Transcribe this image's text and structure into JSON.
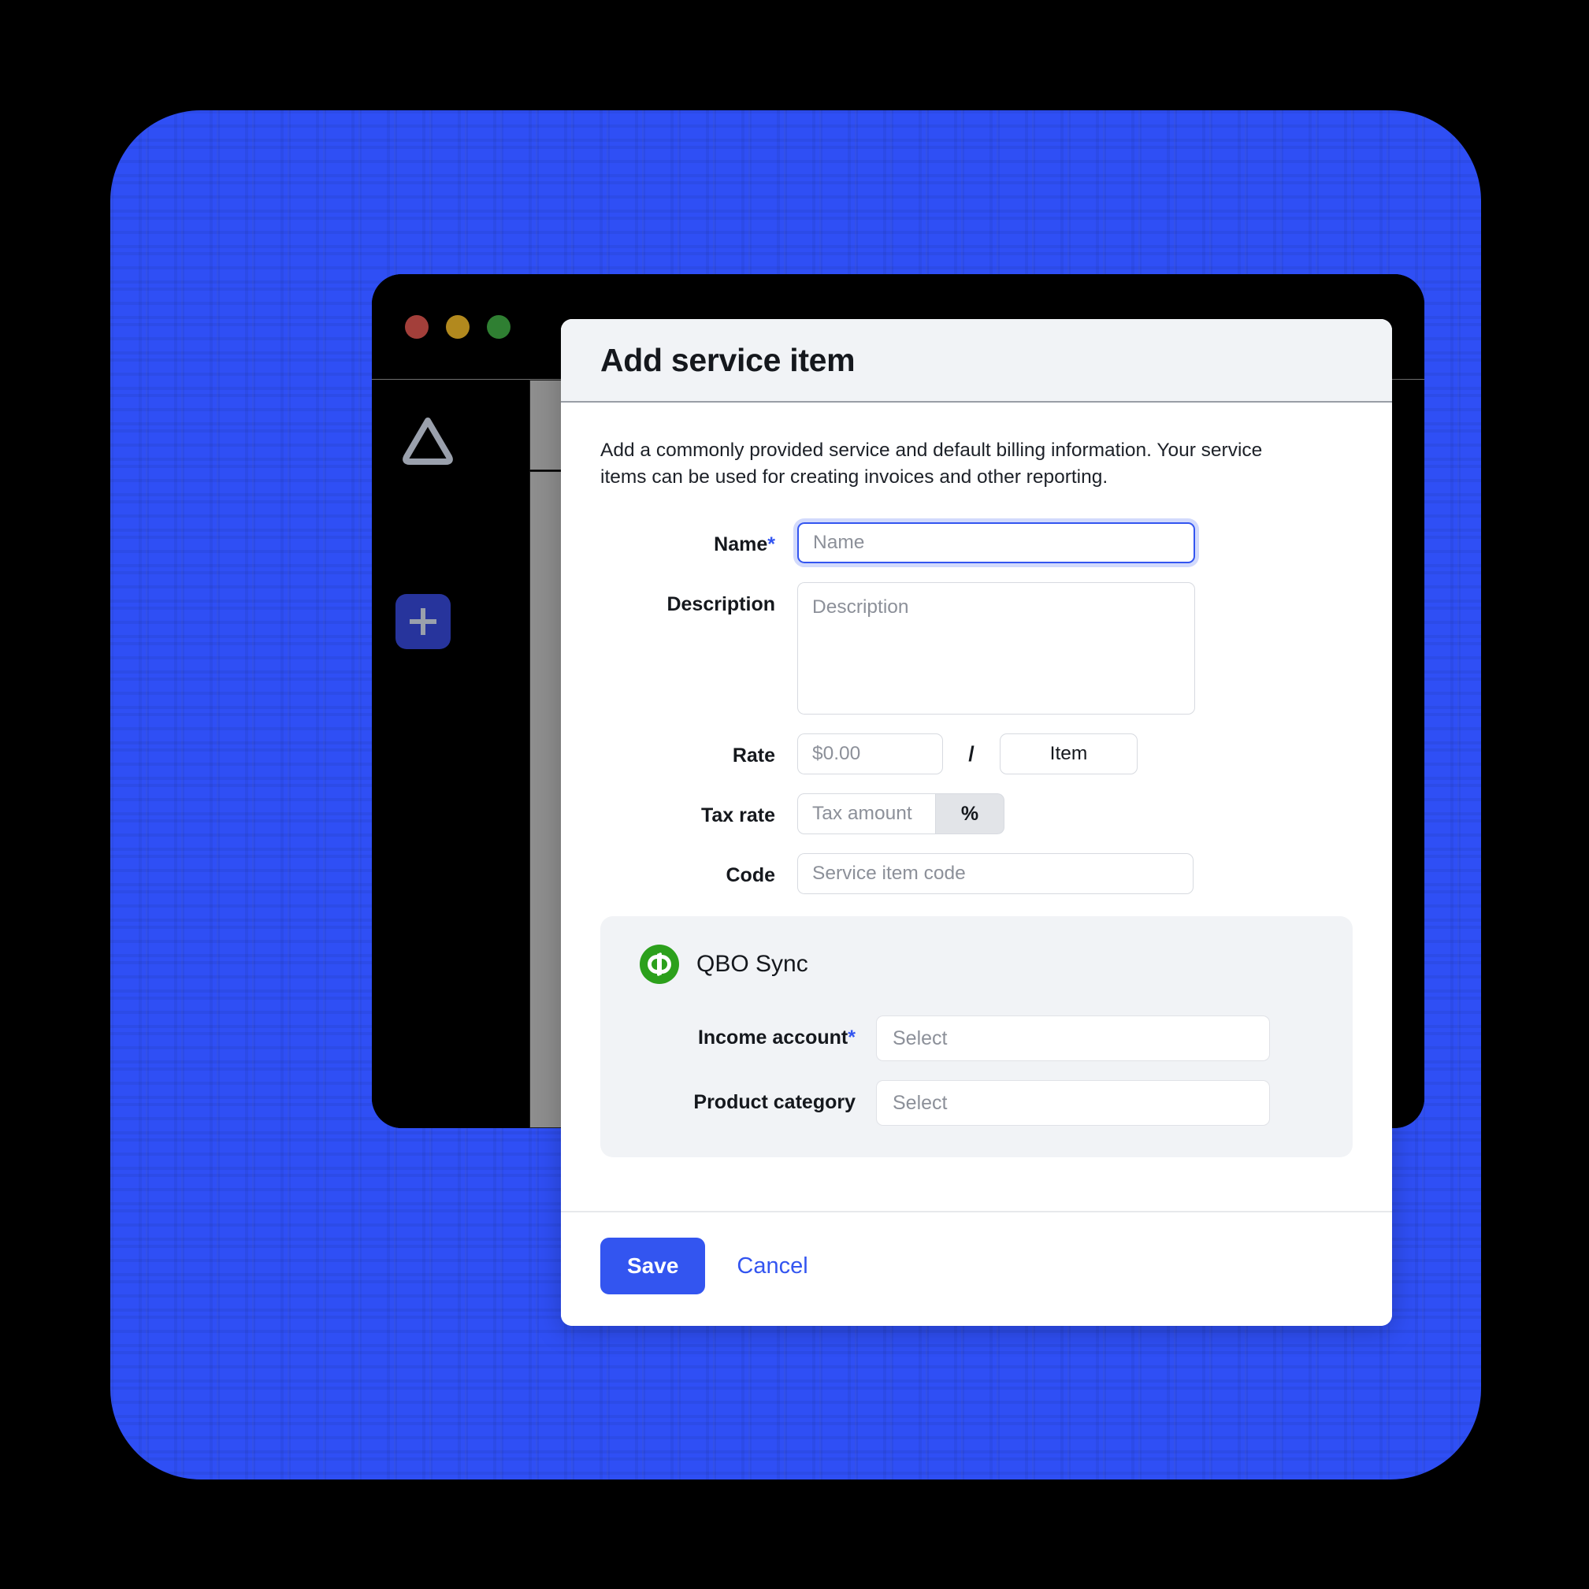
{
  "app": {
    "window_controls": [
      "close",
      "minimize",
      "maximize"
    ],
    "sidebar": {
      "logo_name": "triangle-logo",
      "add_label": "+"
    }
  },
  "modal": {
    "title": "Add service item",
    "description": "Add a commonly provided service and default billing information. Your service items can be used for creating invoices and other reporting.",
    "fields": {
      "name": {
        "label": "Name",
        "required": true,
        "required_marker": "*",
        "placeholder": "Name",
        "value": ""
      },
      "description": {
        "label": "Description",
        "required": false,
        "placeholder": "Description",
        "value": ""
      },
      "rate": {
        "label": "Rate",
        "placeholder": "$0.00",
        "value": "",
        "separator": "/",
        "unit_value": "Item"
      },
      "tax_rate": {
        "label": "Tax rate",
        "placeholder": "Tax amount",
        "value": "",
        "suffix": "%"
      },
      "code": {
        "label": "Code",
        "placeholder": "Service item code",
        "value": ""
      }
    },
    "qbo": {
      "icon_name": "quickbooks-icon",
      "title": "QBO Sync",
      "income_account": {
        "label": "Income account",
        "required": true,
        "required_marker": "*",
        "placeholder": "Select",
        "value": ""
      },
      "product_category": {
        "label": "Product category",
        "required": false,
        "placeholder": "Select",
        "value": ""
      }
    },
    "footer": {
      "save_label": "Save",
      "cancel_label": "Cancel"
    }
  },
  "colors": {
    "brand_blue": "#3355f0",
    "backdrop_blue": "#2f4ff5",
    "qbo_green": "#2ca01c",
    "header_gray": "#f1f3f6",
    "traffic_red": "#a33f3a",
    "traffic_yellow": "#b2891e",
    "traffic_green": "#2f7f32"
  }
}
